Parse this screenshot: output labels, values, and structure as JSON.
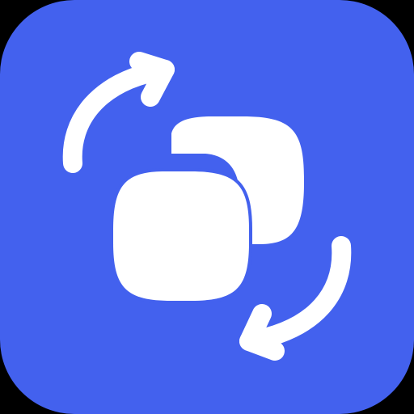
{
  "app_icon": {
    "icon": "swap-layers-icon",
    "description_free": true,
    "colors": {
      "page_background": "#000000",
      "tile_background": "#4361EE",
      "glyph": "#FFFFFF"
    },
    "parts": {
      "top_arrow": "rotate-arrow-clockwise-icon",
      "bottom_arrow": "rotate-arrow-clockwise-icon",
      "front_square": "rounded-square-icon",
      "back_square": "rounded-square-icon"
    }
  }
}
